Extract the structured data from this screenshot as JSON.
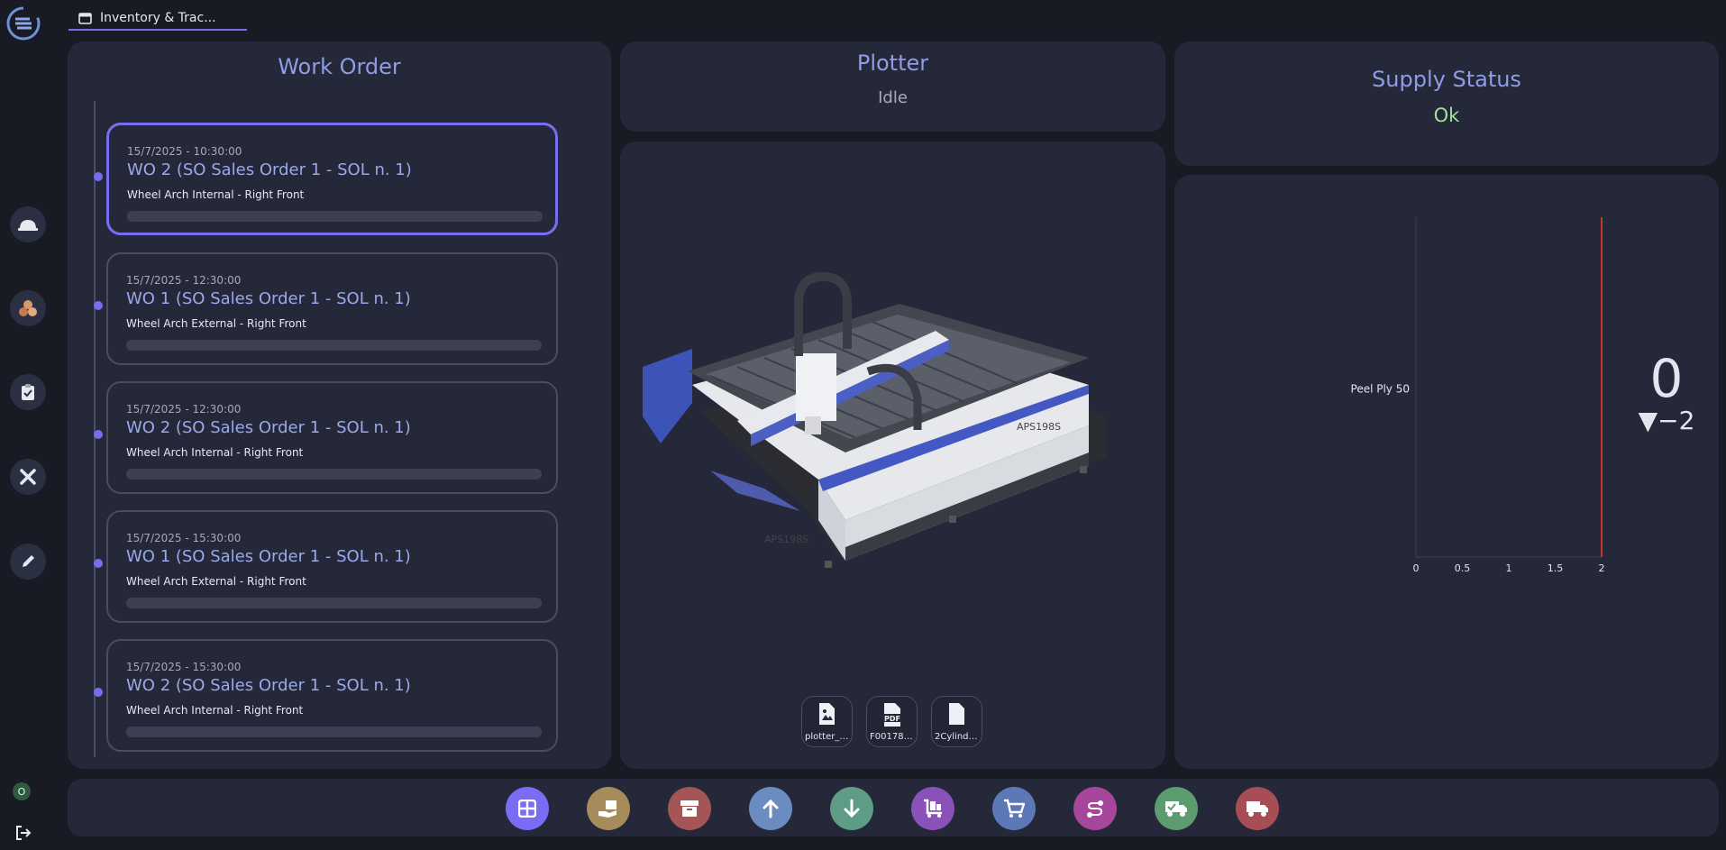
{
  "app": {
    "tab_title": "Inventory & Trac..."
  },
  "rail": {
    "items": [
      "worker-helmet-icon",
      "materials-icon",
      "clipboard-check-icon",
      "tools-icon",
      "pencil-icon"
    ],
    "user_initial": "O"
  },
  "work_order": {
    "title": "Work Order",
    "orders": [
      {
        "datetime": "15/7/2025 - 10:30:00",
        "title": "WO 2 (SO Sales Order 1 - SOL n. 1)",
        "description": "Wheel Arch Internal - Right Front",
        "progress": 0,
        "selected": true
      },
      {
        "datetime": "15/7/2025 - 12:30:00",
        "title": "WO 1 (SO Sales Order 1 - SOL n. 1)",
        "description": "Wheel Arch External - Right Front",
        "progress": 0,
        "selected": false
      },
      {
        "datetime": "15/7/2025 - 12:30:00",
        "title": "WO 2 (SO Sales Order 1 - SOL n. 1)",
        "description": "Wheel Arch Internal - Right Front",
        "progress": 0,
        "selected": false
      },
      {
        "datetime": "15/7/2025 - 15:30:00",
        "title": "WO 1 (SO Sales Order 1 - SOL n. 1)",
        "description": "Wheel Arch External - Right Front",
        "progress": 0,
        "selected": false
      },
      {
        "datetime": "15/7/2025 - 15:30:00",
        "title": "WO 2 (SO Sales Order 1 - SOL n. 1)",
        "description": "Wheel Arch Internal - Right Front",
        "progress": 0,
        "selected": false
      }
    ]
  },
  "plotter": {
    "title": "Plotter",
    "status": "Idle",
    "machine_label": "APS198S",
    "files": [
      {
        "label": "plotter_i...",
        "icon": "image-file-icon"
      },
      {
        "label": "F001788...",
        "icon": "pdf-file-icon"
      },
      {
        "label": "2Cylinde...",
        "icon": "file-icon"
      }
    ]
  },
  "supply": {
    "title": "Supply Status",
    "status": "Ok",
    "value": "0",
    "delta": "▼−2",
    "colors": {
      "status": "#9fe39a",
      "threshold": "#c0392b"
    }
  },
  "chart_data": {
    "type": "bar",
    "orientation": "horizontal",
    "categories": [
      "Peel Ply 50"
    ],
    "values": [
      0
    ],
    "xlim": [
      0,
      2
    ],
    "x_ticks": [
      "0",
      "0.5",
      "1",
      "1.5",
      "2"
    ],
    "threshold": 2
  },
  "actions": [
    {
      "name": "dashboard-action",
      "icon": "grid-icon",
      "color": "#7b6cf6"
    },
    {
      "name": "deliver-action",
      "icon": "hand-box-icon",
      "color": "#a68b5b"
    },
    {
      "name": "archive-action",
      "icon": "archive-icon",
      "color": "#a45555"
    },
    {
      "name": "upload-action",
      "icon": "arrow-up-icon",
      "color": "#6b8cc0"
    },
    {
      "name": "download-action",
      "icon": "arrow-down-icon",
      "color": "#5e9c85"
    },
    {
      "name": "cart-items-action",
      "icon": "dolly-box-icon",
      "color": "#8a52b8"
    },
    {
      "name": "cart-action",
      "icon": "cart-icon",
      "color": "#5c78b6"
    },
    {
      "name": "route-action",
      "icon": "route-icon",
      "color": "#a6479b"
    },
    {
      "name": "truck-ok-action",
      "icon": "truck-check-icon",
      "color": "#5d9c6e"
    },
    {
      "name": "truck-action",
      "icon": "truck-icon",
      "color": "#a64d55"
    }
  ]
}
